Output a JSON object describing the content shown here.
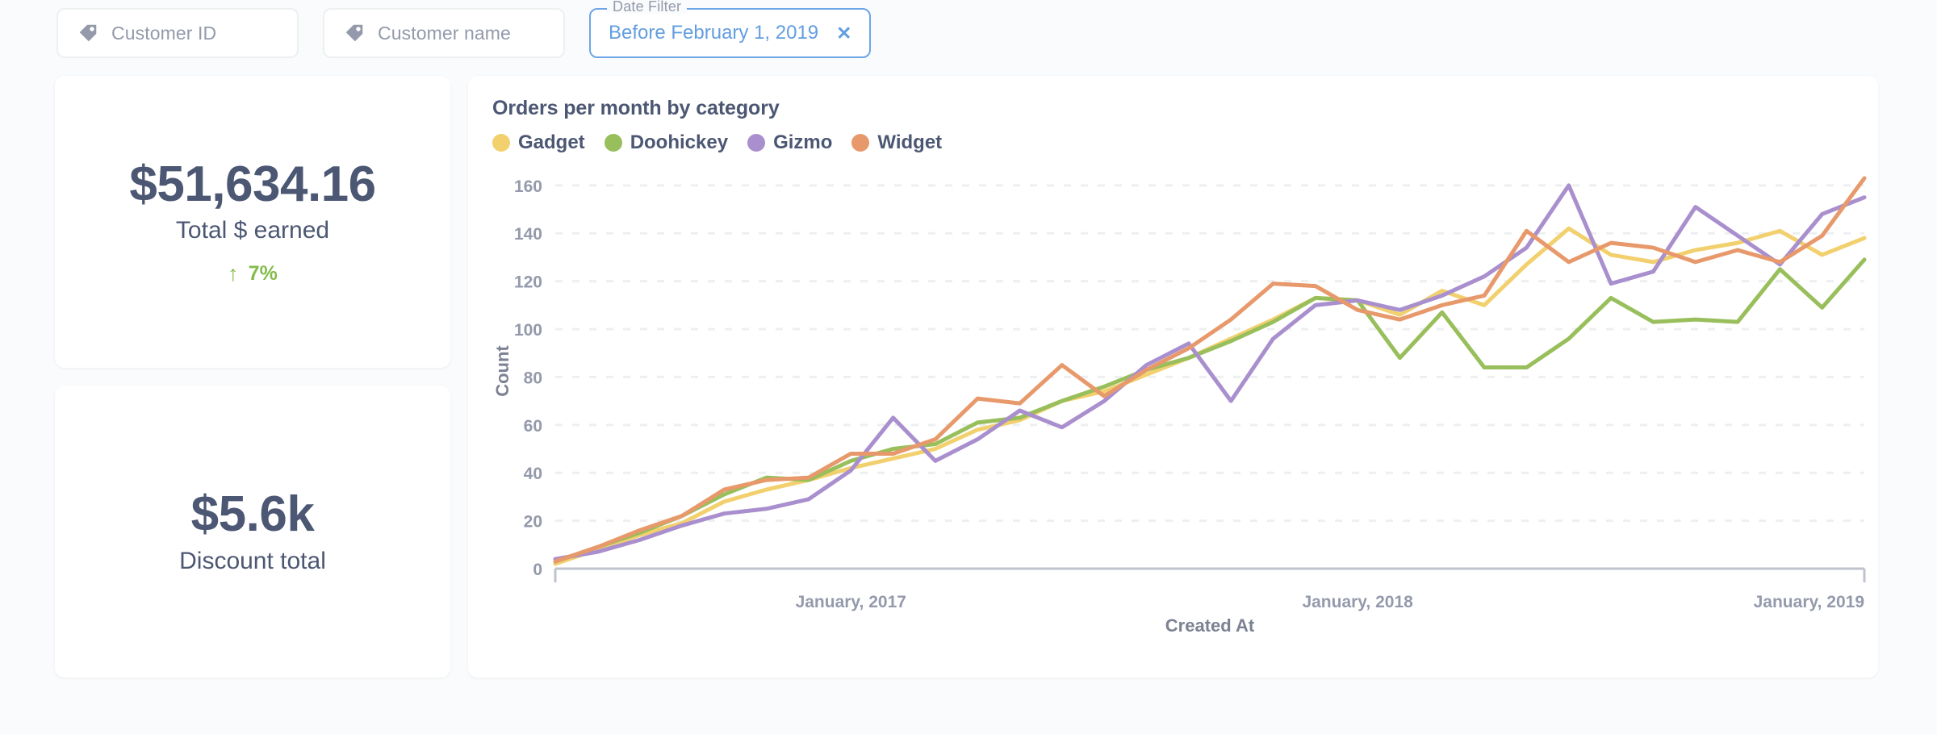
{
  "filters": [
    {
      "icon": "tag-icon",
      "placeholder": "Customer ID",
      "value": "",
      "active": false,
      "name": "customer-id"
    },
    {
      "icon": "tag-icon",
      "placeholder": "Customer name",
      "value": "",
      "active": false,
      "name": "customer-name"
    }
  ],
  "date_filter": {
    "legend": "Date Filter",
    "value": "Before February 1, 2019",
    "clear_label": "✕",
    "accent": "#639EE0"
  },
  "scalars": [
    {
      "value": "$51,634.16",
      "title": "Total $ earned",
      "trend_arrow": "↑",
      "trend_value": "7%",
      "trend_color": "#84BB4C"
    },
    {
      "value": "$5.6k",
      "title": "Discount total",
      "trend_arrow": "",
      "trend_value": "",
      "trend_color": ""
    }
  ],
  "chart_data": {
    "type": "line",
    "title": "Orders per month by category",
    "xlabel": "Created At",
    "ylabel": "Count",
    "ylim": [
      0,
      165
    ],
    "yticks": [
      0,
      20,
      40,
      60,
      80,
      100,
      120,
      140,
      160
    ],
    "grid": true,
    "legend_position": "top",
    "x": [
      "June, 2016",
      "July, 2016",
      "August, 2016",
      "September, 2016",
      "October, 2016",
      "November, 2016",
      "December, 2016",
      "January, 2017",
      "February, 2017",
      "March, 2017",
      "April, 2017",
      "May, 2017",
      "June, 2017",
      "July, 2017",
      "August, 2017",
      "September, 2017",
      "October, 2017",
      "November, 2017",
      "December, 2017",
      "January, 2018",
      "February, 2018",
      "March, 2018",
      "April, 2018",
      "May, 2018",
      "June, 2018",
      "July, 2018",
      "August, 2018",
      "September, 2018",
      "October, 2018",
      "November, 2018",
      "December, 2018",
      "January, 2019"
    ],
    "xticks": [
      "January, 2017",
      "January, 2018",
      "January, 2019"
    ],
    "xtick_indices": [
      7,
      19,
      31
    ],
    "series": [
      {
        "name": "Gadget",
        "color": "#F2D06E",
        "values": [
          2,
          8,
          14,
          19,
          28,
          33,
          37,
          42,
          46,
          50,
          58,
          62,
          70,
          74,
          81,
          88,
          96,
          104,
          113,
          112,
          106,
          116,
          110,
          127,
          142,
          131,
          128,
          133,
          136,
          141,
          131,
          138
        ]
      },
      {
        "name": "Doohickey",
        "color": "#98BF5B",
        "values": [
          3,
          9,
          15,
          22,
          31,
          38,
          37,
          45,
          50,
          52,
          61,
          63,
          70,
          76,
          83,
          88,
          95,
          103,
          113,
          112,
          88,
          107,
          84,
          84,
          96,
          113,
          103,
          104,
          103,
          125,
          109,
          129
        ]
      },
      {
        "name": "Gizmo",
        "color": "#A98FCD",
        "values": [
          4,
          7,
          12,
          18,
          23,
          25,
          29,
          41,
          63,
          45,
          54,
          66,
          59,
          70,
          85,
          94,
          70,
          96,
          110,
          112,
          108,
          114,
          122,
          134,
          160,
          119,
          124,
          151,
          139,
          127,
          148,
          155
        ]
      },
      {
        "name": "Widget",
        "color": "#E8996B",
        "values": [
          3,
          9,
          16,
          22,
          33,
          37,
          38,
          48,
          48,
          54,
          71,
          69,
          85,
          72,
          83,
          92,
          104,
          119,
          118,
          108,
          104,
          110,
          114,
          141,
          128,
          136,
          134,
          128,
          133,
          128,
          139,
          163
        ]
      }
    ]
  }
}
